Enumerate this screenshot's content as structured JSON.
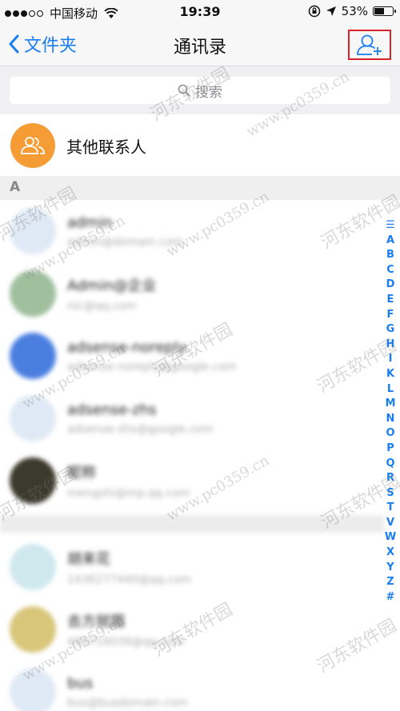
{
  "status_bar": {
    "carrier": "中国移动",
    "time": "19:39",
    "battery_text": "53%",
    "battery_level": 0.53
  },
  "nav": {
    "back_label": "文件夹",
    "title": "通讯录"
  },
  "search": {
    "placeholder": "搜索"
  },
  "other_contacts": {
    "label": "其他联系人"
  },
  "section": {
    "letter": "A"
  },
  "contacts": [
    {
      "name": "admin",
      "sub": "admin@domain.com",
      "avatar_color": "#dfe9f5"
    },
    {
      "name": "Admin@企业",
      "sub": "nic@qq.com",
      "avatar_color": "#9fbf9d"
    },
    {
      "name": "adsense-noreply",
      "sub": "adsense-noreply@google.com",
      "avatar_color": "#4a7fe0"
    },
    {
      "name": "adsense-zhs",
      "sub": "adsense-zhs@google.com",
      "avatar_color": "#dfe9f5"
    },
    {
      "name": "昵称",
      "sub": "mengshi@mp.qq.com",
      "avatar_color": "#3c3a2c"
    },
    {
      "name": "胡来花",
      "sub": "1436277440@qq.com",
      "avatar_color": "#cfe8ee"
    },
    {
      "name": "去方就圆",
      "sub": "490716039@qq.com",
      "avatar_color": "#d8c67a"
    },
    {
      "name": "bus",
      "sub": "bus@busdomain.com",
      "avatar_color": "#dfe9f5"
    }
  ],
  "index_letters": [
    "☰",
    "A",
    "B",
    "C",
    "D",
    "E",
    "F",
    "G",
    "H",
    "I",
    "K",
    "L",
    "M",
    "N",
    "O",
    "P",
    "Q",
    "R",
    "S",
    "T",
    "V",
    "W",
    "X",
    "Y",
    "Z",
    "#"
  ],
  "watermark_text": "河东软件园",
  "watermark_url": "www.pc0359.cn"
}
